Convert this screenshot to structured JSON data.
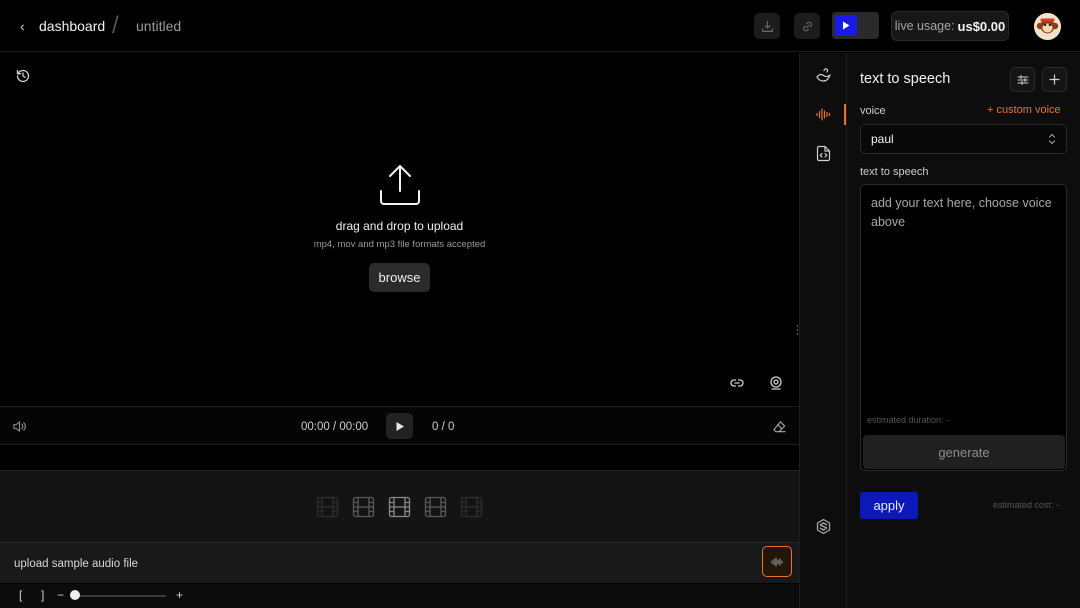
{
  "header": {
    "back_glyph": "‹",
    "breadcrumb_dashboard": "dashboard",
    "breadcrumb_separator": "/",
    "project_title": "untitled",
    "live_usage_label": "live usage:",
    "live_usage_value": "us$0.00"
  },
  "icons": {
    "download": "download-icon",
    "share": "link-icon",
    "play_toggle": "play-icon",
    "avatar": "monkey-avatar"
  },
  "editor": {
    "drop_title": "drag and drop to upload",
    "drop_subtitle": "mp4, mov and mp3 file formats accepted",
    "browse_label": "browse"
  },
  "player": {
    "time": "00:00 / 00:00",
    "count": "0 / 0"
  },
  "audio": {
    "label": "upload sample audio file"
  },
  "zoom": {
    "open_bracket": "[",
    "close_bracket": "]",
    "minus": "−",
    "plus": "+",
    "level": 0
  },
  "panel": {
    "title": "text to speech",
    "voice_label": "voice",
    "custom_voice": "+ custom voice",
    "voice_value": "paul",
    "text_label": "text to speech",
    "text_placeholder": "add your text here, choose voice above",
    "estimated_duration": "estimated duration:  -",
    "generate_label": "generate",
    "apply_label": "apply",
    "estimated_cost": "estimated cost:  -"
  },
  "colors": {
    "accent_orange": "#e8742a",
    "accent_blue": "#1a1ae8",
    "apply_blue": "#0d18b8"
  }
}
